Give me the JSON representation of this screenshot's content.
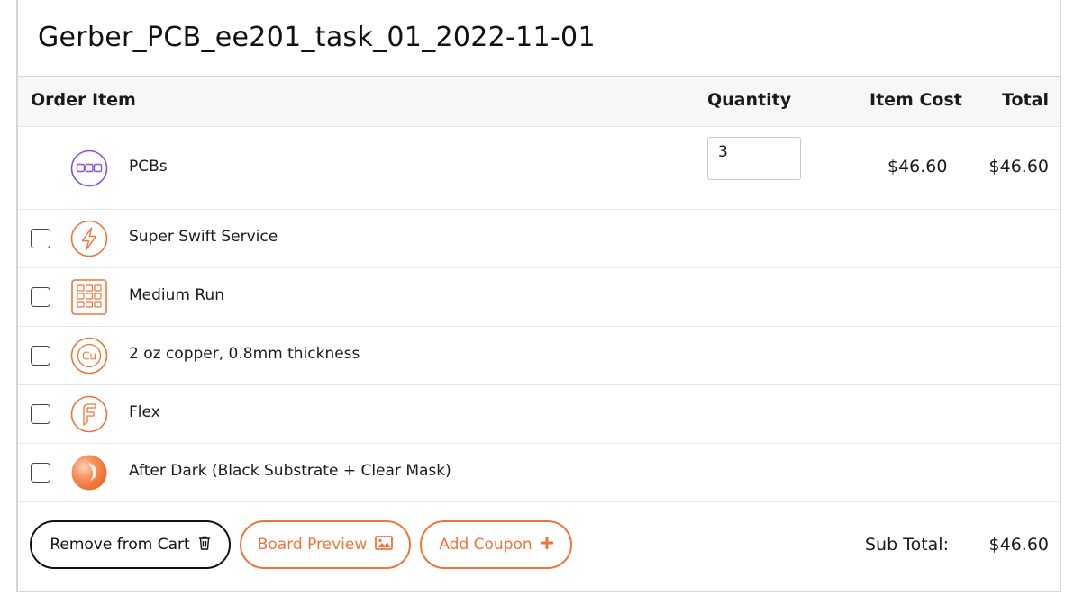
{
  "order": {
    "title": "Gerber_PCB_ee201_task_01_2022-11-01"
  },
  "table": {
    "headers": {
      "item": "Order Item",
      "quantity": "Quantity",
      "item_cost": "Item Cost",
      "total": "Total"
    },
    "main_item": {
      "label": "PCBs",
      "icon": "pcb-board-icon",
      "quantity": "3",
      "item_cost": "$46.60",
      "total": "$46.60"
    },
    "options": [
      {
        "label": "Super Swift Service",
        "icon": "lightning-icon",
        "checked": false
      },
      {
        "label": "Medium Run",
        "icon": "panel-grid-icon",
        "checked": false
      },
      {
        "label": "2 oz copper, 0.8mm thickness",
        "icon": "copper-cu-icon",
        "checked": false
      },
      {
        "label": "Flex",
        "icon": "flex-icon",
        "checked": false
      },
      {
        "label": "After Dark (Black Substrate + Clear Mask)",
        "icon": "after-dark-icon",
        "checked": false
      }
    ]
  },
  "footer": {
    "remove_label": "Remove from Cart",
    "preview_label": "Board Preview",
    "coupon_label": "Add Coupon",
    "subtotal_label": "Sub Total:",
    "subtotal_value": "$46.60"
  },
  "colors": {
    "accent": "#f0743a",
    "pcb_icon": "#8a4fe0",
    "border": "#d6d6d6"
  }
}
